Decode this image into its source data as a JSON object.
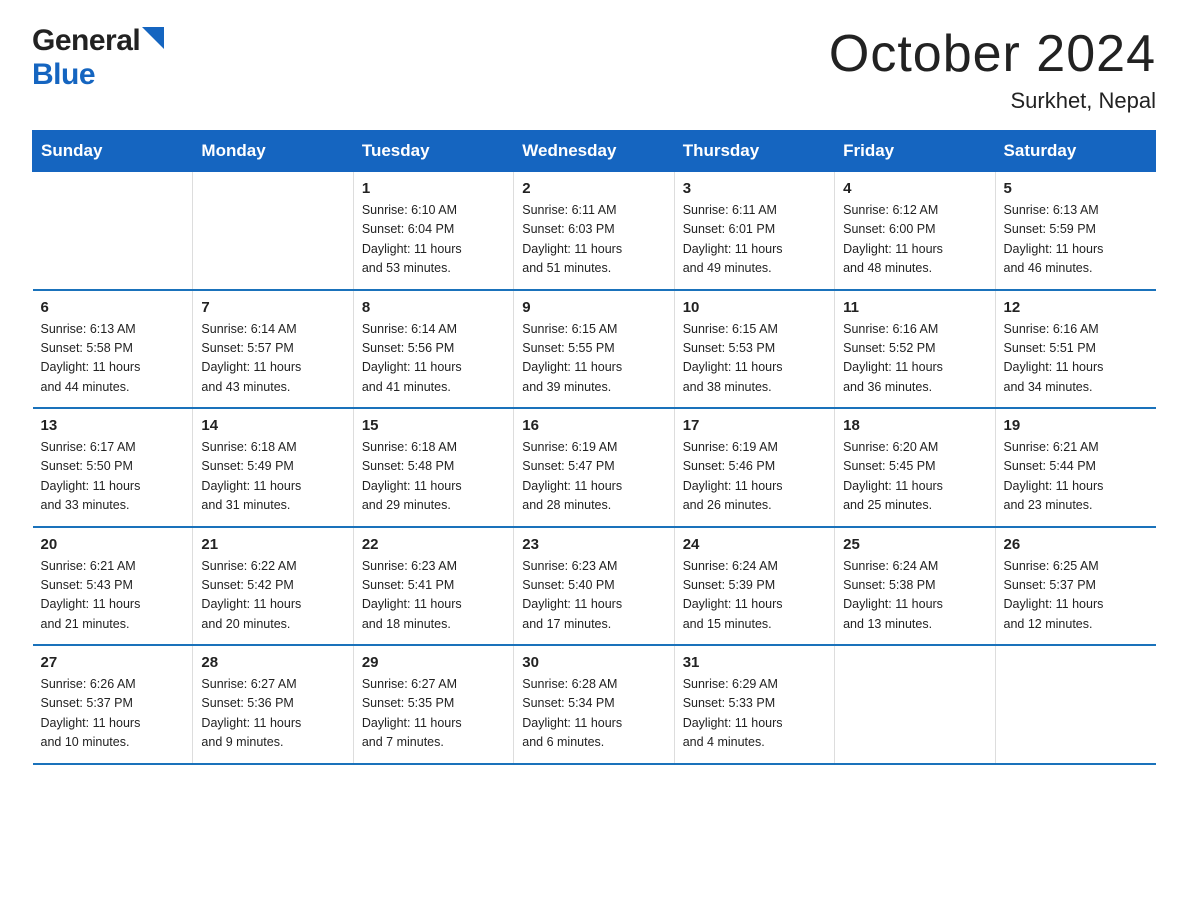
{
  "header": {
    "logo_general": "General",
    "logo_blue": "Blue",
    "title": "October 2024",
    "subtitle": "Surkhet, Nepal"
  },
  "weekdays": [
    "Sunday",
    "Monday",
    "Tuesday",
    "Wednesday",
    "Thursday",
    "Friday",
    "Saturday"
  ],
  "weeks": [
    [
      {
        "day": "",
        "info": ""
      },
      {
        "day": "",
        "info": ""
      },
      {
        "day": "1",
        "info": "Sunrise: 6:10 AM\nSunset: 6:04 PM\nDaylight: 11 hours\nand 53 minutes."
      },
      {
        "day": "2",
        "info": "Sunrise: 6:11 AM\nSunset: 6:03 PM\nDaylight: 11 hours\nand 51 minutes."
      },
      {
        "day": "3",
        "info": "Sunrise: 6:11 AM\nSunset: 6:01 PM\nDaylight: 11 hours\nand 49 minutes."
      },
      {
        "day": "4",
        "info": "Sunrise: 6:12 AM\nSunset: 6:00 PM\nDaylight: 11 hours\nand 48 minutes."
      },
      {
        "day": "5",
        "info": "Sunrise: 6:13 AM\nSunset: 5:59 PM\nDaylight: 11 hours\nand 46 minutes."
      }
    ],
    [
      {
        "day": "6",
        "info": "Sunrise: 6:13 AM\nSunset: 5:58 PM\nDaylight: 11 hours\nand 44 minutes."
      },
      {
        "day": "7",
        "info": "Sunrise: 6:14 AM\nSunset: 5:57 PM\nDaylight: 11 hours\nand 43 minutes."
      },
      {
        "day": "8",
        "info": "Sunrise: 6:14 AM\nSunset: 5:56 PM\nDaylight: 11 hours\nand 41 minutes."
      },
      {
        "day": "9",
        "info": "Sunrise: 6:15 AM\nSunset: 5:55 PM\nDaylight: 11 hours\nand 39 minutes."
      },
      {
        "day": "10",
        "info": "Sunrise: 6:15 AM\nSunset: 5:53 PM\nDaylight: 11 hours\nand 38 minutes."
      },
      {
        "day": "11",
        "info": "Sunrise: 6:16 AM\nSunset: 5:52 PM\nDaylight: 11 hours\nand 36 minutes."
      },
      {
        "day": "12",
        "info": "Sunrise: 6:16 AM\nSunset: 5:51 PM\nDaylight: 11 hours\nand 34 minutes."
      }
    ],
    [
      {
        "day": "13",
        "info": "Sunrise: 6:17 AM\nSunset: 5:50 PM\nDaylight: 11 hours\nand 33 minutes."
      },
      {
        "day": "14",
        "info": "Sunrise: 6:18 AM\nSunset: 5:49 PM\nDaylight: 11 hours\nand 31 minutes."
      },
      {
        "day": "15",
        "info": "Sunrise: 6:18 AM\nSunset: 5:48 PM\nDaylight: 11 hours\nand 29 minutes."
      },
      {
        "day": "16",
        "info": "Sunrise: 6:19 AM\nSunset: 5:47 PM\nDaylight: 11 hours\nand 28 minutes."
      },
      {
        "day": "17",
        "info": "Sunrise: 6:19 AM\nSunset: 5:46 PM\nDaylight: 11 hours\nand 26 minutes."
      },
      {
        "day": "18",
        "info": "Sunrise: 6:20 AM\nSunset: 5:45 PM\nDaylight: 11 hours\nand 25 minutes."
      },
      {
        "day": "19",
        "info": "Sunrise: 6:21 AM\nSunset: 5:44 PM\nDaylight: 11 hours\nand 23 minutes."
      }
    ],
    [
      {
        "day": "20",
        "info": "Sunrise: 6:21 AM\nSunset: 5:43 PM\nDaylight: 11 hours\nand 21 minutes."
      },
      {
        "day": "21",
        "info": "Sunrise: 6:22 AM\nSunset: 5:42 PM\nDaylight: 11 hours\nand 20 minutes."
      },
      {
        "day": "22",
        "info": "Sunrise: 6:23 AM\nSunset: 5:41 PM\nDaylight: 11 hours\nand 18 minutes."
      },
      {
        "day": "23",
        "info": "Sunrise: 6:23 AM\nSunset: 5:40 PM\nDaylight: 11 hours\nand 17 minutes."
      },
      {
        "day": "24",
        "info": "Sunrise: 6:24 AM\nSunset: 5:39 PM\nDaylight: 11 hours\nand 15 minutes."
      },
      {
        "day": "25",
        "info": "Sunrise: 6:24 AM\nSunset: 5:38 PM\nDaylight: 11 hours\nand 13 minutes."
      },
      {
        "day": "26",
        "info": "Sunrise: 6:25 AM\nSunset: 5:37 PM\nDaylight: 11 hours\nand 12 minutes."
      }
    ],
    [
      {
        "day": "27",
        "info": "Sunrise: 6:26 AM\nSunset: 5:37 PM\nDaylight: 11 hours\nand 10 minutes."
      },
      {
        "day": "28",
        "info": "Sunrise: 6:27 AM\nSunset: 5:36 PM\nDaylight: 11 hours\nand 9 minutes."
      },
      {
        "day": "29",
        "info": "Sunrise: 6:27 AM\nSunset: 5:35 PM\nDaylight: 11 hours\nand 7 minutes."
      },
      {
        "day": "30",
        "info": "Sunrise: 6:28 AM\nSunset: 5:34 PM\nDaylight: 11 hours\nand 6 minutes."
      },
      {
        "day": "31",
        "info": "Sunrise: 6:29 AM\nSunset: 5:33 PM\nDaylight: 11 hours\nand 4 minutes."
      },
      {
        "day": "",
        "info": ""
      },
      {
        "day": "",
        "info": ""
      }
    ]
  ],
  "colors": {
    "header_bg": "#1565c0",
    "header_text": "#ffffff",
    "border": "#1a72bb",
    "accent": "#1565c0"
  }
}
